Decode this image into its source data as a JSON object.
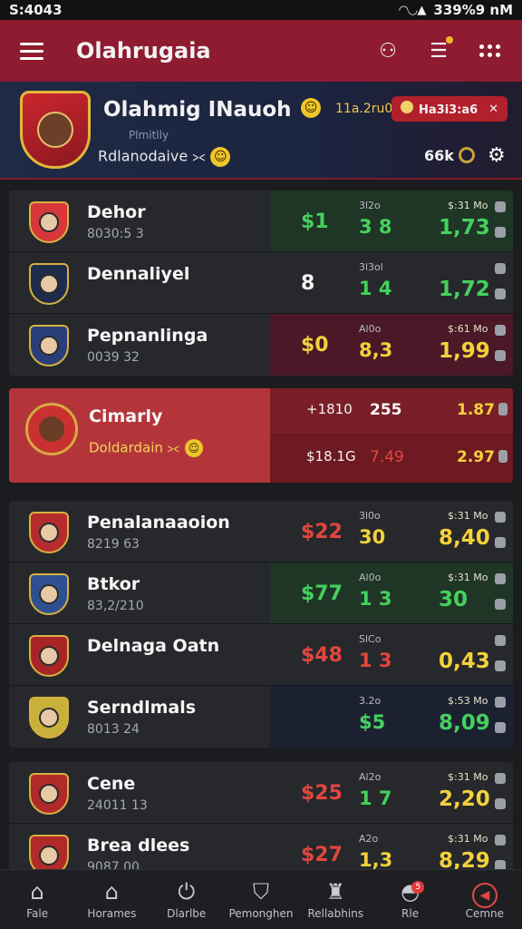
{
  "status": {
    "left": "S:4043",
    "right": "339%9 nM"
  },
  "app_bar": {
    "title": "Olahrugaia"
  },
  "team": {
    "name": "Olahmig INauoh",
    "subtitle": "Plmitlly",
    "role": "Rdlanodaive ⪥",
    "time": "11a.2ru0",
    "score": "Ha3i3:a6",
    "followers": "66k"
  },
  "groups": [
    {
      "rows": [
        {
          "name": "Dehor",
          "meta": "8030:5 3",
          "bg": "green",
          "odd1": "$1",
          "odd1_color": "green",
          "lbl2": "3l2o",
          "odd2": "3 8",
          "odd2_color": "green",
          "lbl3": "$:31 Mo",
          "odd3": "1,73",
          "odd3_color": "green",
          "crest": "#d7363a"
        },
        {
          "name": "Dennaliyel",
          "meta": "",
          "bg": "dark",
          "odd1": "8",
          "odd1_color": "white",
          "lbl2": "3l3ol",
          "odd2": "1 4",
          "odd2_color": "green",
          "lbl3": "",
          "odd3": "1,72",
          "odd3_color": "green",
          "crest": "#1f2b4a"
        },
        {
          "name": "Pepnanlinga",
          "meta": "0039 32",
          "bg": "maroon",
          "odd1": "$0",
          "odd1_color": "yellow",
          "lbl2": "Al0o",
          "odd2": "8,3",
          "odd2_color": "yellow",
          "lbl3": "$:61 Mo",
          "odd3": "1,99",
          "odd3_color": "yellow",
          "crest": "#2a3f7a"
        }
      ]
    },
    {
      "rows": [
        {
          "name": "Penalanaaoion",
          "meta": "8219 63",
          "bg": "dark",
          "odd1": "$22",
          "odd1_color": "red",
          "lbl2": "3l0o",
          "odd2": "30",
          "odd2_color": "yellow",
          "lbl3": "$:31 Mo",
          "odd3": "8,40",
          "odd3_color": "yellow",
          "crest": "#b62c2c"
        },
        {
          "name": "Btkor",
          "meta": "83,2/210",
          "bg": "green",
          "odd1": "$77",
          "odd1_color": "green",
          "lbl2": "Al0o",
          "odd2": "1 3",
          "odd2_color": "green",
          "lbl3": "$:31 Mo",
          "odd3": "30",
          "odd3_color": "green",
          "crest": "#2e5090"
        },
        {
          "name": "Delnaga Oatn",
          "meta": "",
          "bg": "dark",
          "odd1": "$48",
          "odd1_color": "red",
          "lbl2": "SlCo",
          "odd2": "1 3",
          "odd2_color": "red",
          "lbl3": "",
          "odd3": "0,43",
          "odd3_color": "yellow",
          "crest": "#a82525"
        },
        {
          "name": "Serndlmals",
          "meta": "8013 24",
          "bg": "navy",
          "odd1": "",
          "odd1_color": "red",
          "lbl2": "3.2o",
          "odd2": "$5",
          "odd2_color": "green",
          "lbl3": "$:53 Mo",
          "odd3": "8,09",
          "odd3_color": "green",
          "crest": "#c8b03a"
        }
      ]
    },
    {
      "rows": [
        {
          "name": "Cene",
          "meta": "24011 13",
          "bg": "dark",
          "odd1": "$25",
          "odd1_color": "red",
          "lbl2": "Al2o",
          "odd2": "1 7",
          "odd2_color": "green",
          "lbl3": "$:31 Mo",
          "odd3": "2,20",
          "odd3_color": "yellow",
          "crest": "#b02a2a"
        },
        {
          "name": "Brea dlees",
          "meta": "9087 00",
          "bg": "dark",
          "odd1": "$27",
          "odd1_color": "red",
          "lbl2": "A2o",
          "odd2": "1,3",
          "odd2_color": "yellow",
          "lbl3": "$:31 Mo",
          "odd3": "8,29",
          "odd3_color": "yellow",
          "crest": "#b02a2a"
        }
      ]
    }
  ],
  "highlight": {
    "name": "Cimarly",
    "meta": "Doldardain",
    "top_a": "+1810",
    "top_b": "255",
    "top_c": "1.87",
    "bot_a": "$18.1G",
    "bot_b": "7.49",
    "bot_c": "2.97"
  },
  "nav": [
    {
      "label": "Fale",
      "icon": "home-outline-icon"
    },
    {
      "label": "Horames",
      "icon": "home-icon"
    },
    {
      "label": "Dlarlbe",
      "icon": "power-icon"
    },
    {
      "label": "Pemonghen",
      "icon": "shield-icon"
    },
    {
      "label": "Rellabhins",
      "icon": "trophy-icon"
    },
    {
      "label": "Rle",
      "icon": "bell-icon",
      "badge": "5"
    },
    {
      "label": "Cemne",
      "icon": "settings-ring-icon"
    }
  ],
  "colors": {
    "accent": "#8e1b30",
    "green": "#45d05e",
    "yellow": "#f3d13c",
    "red": "#e2463e"
  }
}
